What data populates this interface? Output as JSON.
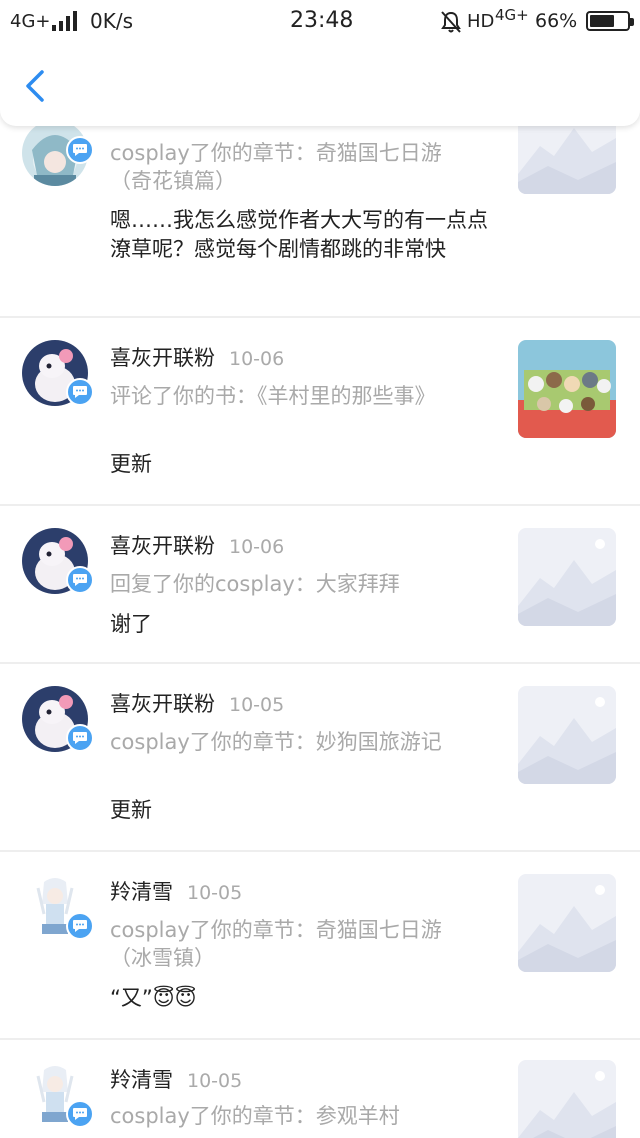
{
  "status_bar": {
    "network": "4G+",
    "speed": "0K/s",
    "time": "23:48",
    "hd": "HD",
    "network2": "4G+",
    "battery": "66%",
    "battery_level": 0.66
  },
  "header": {
    "back_icon": "chevron-left-icon",
    "accent": "#2d8cf0"
  },
  "items": [
    {
      "name": "",
      "date": "",
      "action": "cosplay了你的章节：奇猫国七日游（奇花镇篇）",
      "content": "嗯……我怎么感觉作者大大写的有一点点潦草呢？感觉每个剧情都跳的非常快"
    },
    {
      "name": "喜灰开联粉",
      "date": "10-06",
      "action": "评论了你的书：《羊村里的那些事》",
      "content": "更新"
    },
    {
      "name": "喜灰开联粉",
      "date": "10-06",
      "action": "回复了你的cosplay：大家拜拜",
      "content": "谢了"
    },
    {
      "name": "喜灰开联粉",
      "date": "10-05",
      "action": "cosplay了你的章节：妙狗国旅游记",
      "content": "更新"
    },
    {
      "name": "羚清雪",
      "date": "10-05",
      "action": "cosplay了你的章节：奇猫国七日游（冰雪镇）",
      "content": "“又”😇😇"
    },
    {
      "name": "羚清雪",
      "date": "10-05",
      "action": "cosplay了你的章节：参观羊村",
      "content": ""
    }
  ]
}
